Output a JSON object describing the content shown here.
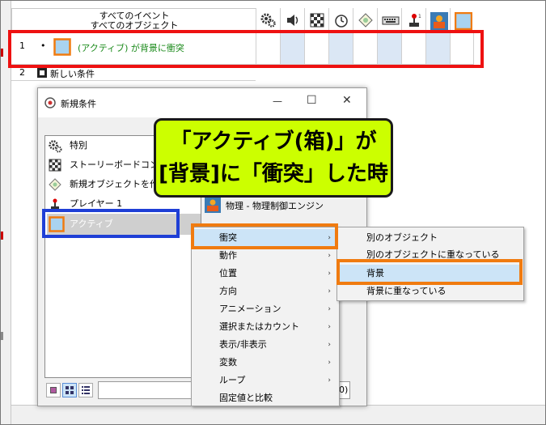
{
  "event_editor": {
    "header_line1": "すべてのイベント",
    "header_line2": "すべてのオブジェクト",
    "row1_number": "1",
    "row1_bullet": "•",
    "row1_condition": "(アクティブ) が背景に衝突",
    "row2_number": "2",
    "row2_label": "新しい条件"
  },
  "dialog": {
    "title": "新規条件",
    "minimize_symbol": "—",
    "maximize_symbol": "☐",
    "close_symbol": "✕",
    "list_items": [
      {
        "label": "特別"
      },
      {
        "label": "ストーリーボードコントロール"
      },
      {
        "label": "新規オブジェクトを作成"
      },
      {
        "label": "プレイヤー 1"
      },
      {
        "label": "アクティブ"
      }
    ],
    "physics_label": "物理 - 物理制御エンジン",
    "bottom_value_fragment": "0)"
  },
  "context_menu": {
    "items": [
      {
        "label": "衝突",
        "arrow": "›"
      },
      {
        "label": "動作",
        "arrow": "›"
      },
      {
        "label": "位置",
        "arrow": "›"
      },
      {
        "label": "方向",
        "arrow": "›"
      },
      {
        "label": "アニメーション",
        "arrow": "›"
      },
      {
        "label": "選択またはカウント",
        "arrow": "›"
      },
      {
        "label": "表示/非表示",
        "arrow": "›"
      },
      {
        "label": "変数",
        "arrow": "›"
      },
      {
        "label": "ループ",
        "arrow": "›"
      },
      {
        "label": "固定値と比較",
        "arrow": ""
      }
    ]
  },
  "submenu": {
    "items": [
      {
        "label": "別のオブジェクト"
      },
      {
        "label": "別のオブジェクトに重なっている"
      },
      {
        "label": "背景"
      },
      {
        "label": "背景に重なっている"
      }
    ]
  },
  "callout": {
    "line1": "「アクティブ(箱)」が",
    "line2": "[背景]に「衝突」した時"
  },
  "colors": {
    "red_highlight": "#ee1111",
    "blue_highlight": "#1f3fd6",
    "orange_highlight": "#f07b10",
    "callout_bg": "#ccff00",
    "condition_text": "#1a8a1a",
    "selection_bg": "#cce4f7"
  }
}
